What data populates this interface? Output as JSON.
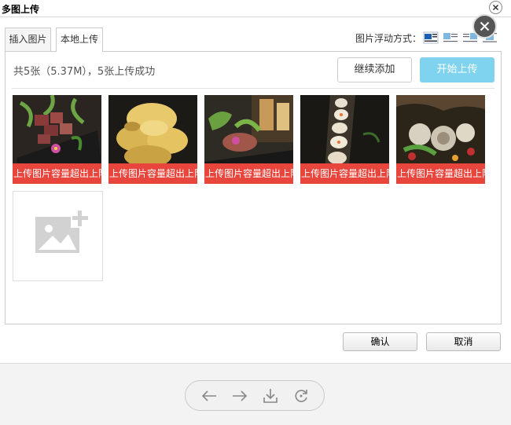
{
  "dialog": {
    "title": "多图上传"
  },
  "tabs": [
    {
      "label": "插入图片"
    },
    {
      "label": "本地上传"
    }
  ],
  "float_mode": {
    "label": "图片浮动方式："
  },
  "upload": {
    "status": "共5张（5.37M），5张上传成功",
    "add_more_label": "继续添加",
    "start_label": "开始上传"
  },
  "images": [
    {
      "error": "上传图片容量超出上限"
    },
    {
      "error": "上传图片容量超出上限"
    },
    {
      "error": "上传图片容量超出上限"
    },
    {
      "error": "上传图片容量超出上限"
    },
    {
      "error": "上传图片容量超出上限"
    }
  ],
  "footer": {
    "ok_label": "确认",
    "cancel_label": "取消"
  },
  "colors": {
    "error_bar": "#e8453c",
    "start_button": "#7fd3ee"
  },
  "icons": [
    "close-icon",
    "float-none-icon",
    "float-left-icon",
    "float-right-icon",
    "float-center-icon",
    "add-image-icon",
    "arrow-left-icon",
    "arrow-right-icon",
    "download-icon",
    "rotate-icon"
  ]
}
